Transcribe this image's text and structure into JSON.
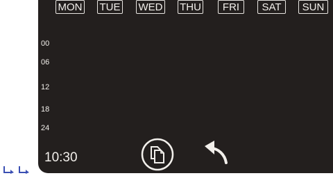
{
  "days": [
    "MON",
    "TUE",
    "WED",
    "THU",
    "FRI",
    "SAT",
    "SUN"
  ],
  "hours": [
    "00",
    "06",
    "12",
    "18",
    "24"
  ],
  "clock": "10:30",
  "icons": {
    "copy": "copy-icon",
    "back": "back-arrow-icon",
    "corner": "arrows-icon"
  },
  "colors": {
    "screen": "#231f1e",
    "foreground": "#f2efeb",
    "accent_corner": "#3a4fb3"
  }
}
